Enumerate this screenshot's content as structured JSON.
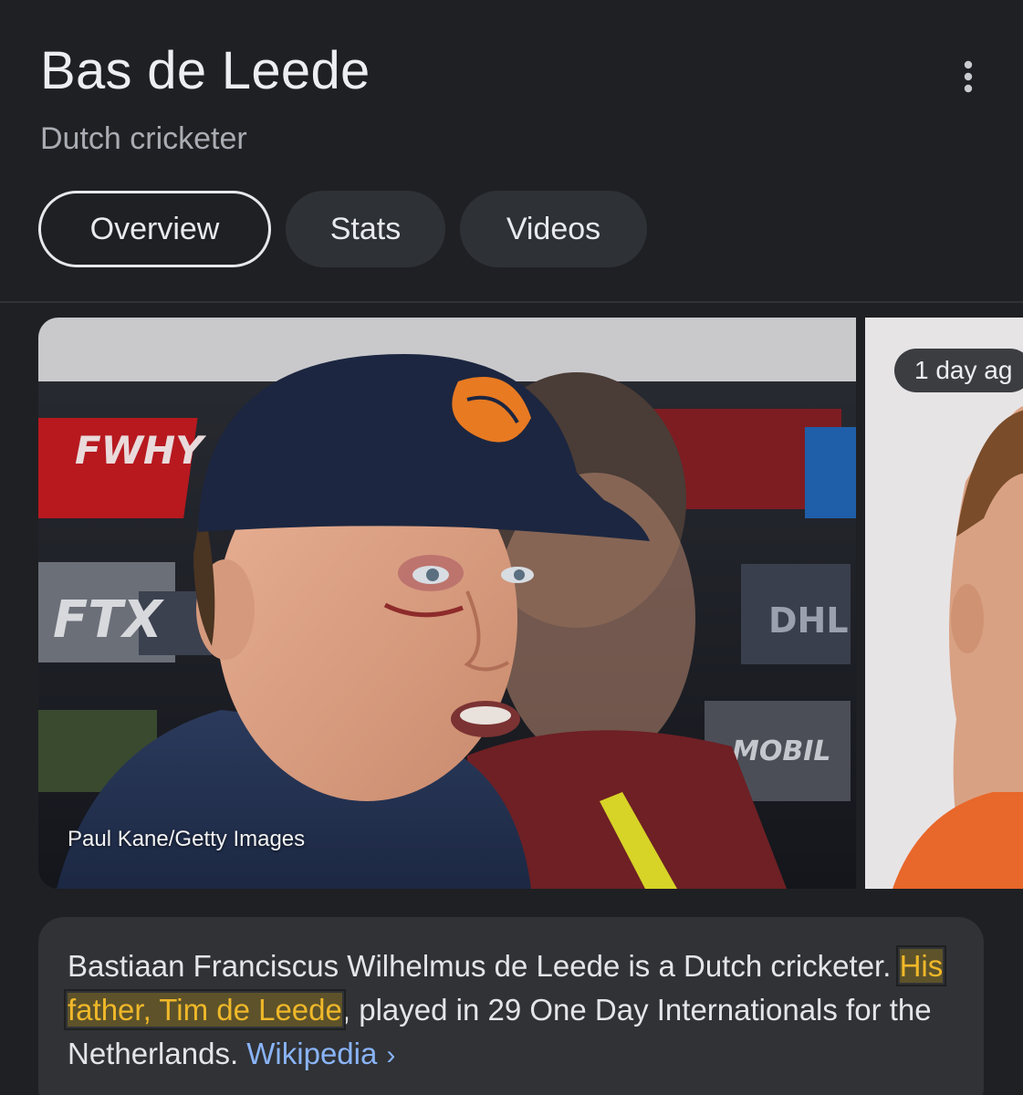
{
  "header": {
    "title": "Bas de Leede",
    "subtitle": "Dutch cricketer",
    "more_icon": "more-vert-icon"
  },
  "tabs": [
    {
      "label": "Overview",
      "active": true
    },
    {
      "label": "Stats",
      "active": false
    },
    {
      "label": "Videos",
      "active": false
    }
  ],
  "media": {
    "main_image": {
      "credit": "Paul Kane/Getty Images",
      "logo_texts": [
        "FTX",
        "DHL",
        "MOBIL",
        "FWHY"
      ]
    },
    "side_image": {
      "badge": "1 day ag"
    }
  },
  "description": {
    "part1": "Bastiaan Franciscus Wilhelmus de Leede is a Dutch cricketer. ",
    "highlight": "His father, Tim de Leede",
    "part2": ", played in 29 One Day Internationals for the Netherlands. ",
    "source_link": "Wikipedia",
    "chevron_icon": "chevron-right-icon"
  },
  "colors": {
    "background": "#1f2023",
    "chip_background": "#2e3135",
    "highlight_text": "#f0b829",
    "link": "#8ab4f8"
  }
}
